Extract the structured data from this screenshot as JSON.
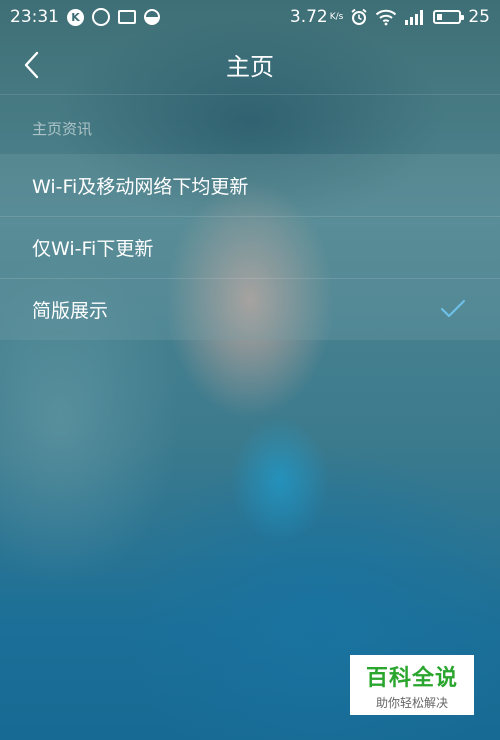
{
  "status_bar": {
    "time": "23:31",
    "network_speed": "3.72",
    "network_speed_unit": "K/s",
    "battery_level": "25",
    "left_icons": [
      "k-app-icon",
      "q-app-icon",
      "image-icon",
      "half-circle-icon"
    ],
    "right_icons": [
      "alarm-icon",
      "wifi-icon",
      "signal-icon",
      "battery-icon"
    ]
  },
  "header": {
    "title": "主页",
    "back_icon": "chevron-left-icon"
  },
  "section": {
    "label": "主页资讯"
  },
  "options": [
    {
      "label": "Wi-Fi及移动网络下均更新",
      "selected": false
    },
    {
      "label": "仅Wi-Fi下更新",
      "selected": false
    },
    {
      "label": "简版展示",
      "selected": true
    }
  ],
  "colors": {
    "check": "#6fc3ea",
    "badge_text": "#2aa52e"
  },
  "watermark": {
    "title": "百科全说",
    "subtitle": "助你轻松解决"
  }
}
